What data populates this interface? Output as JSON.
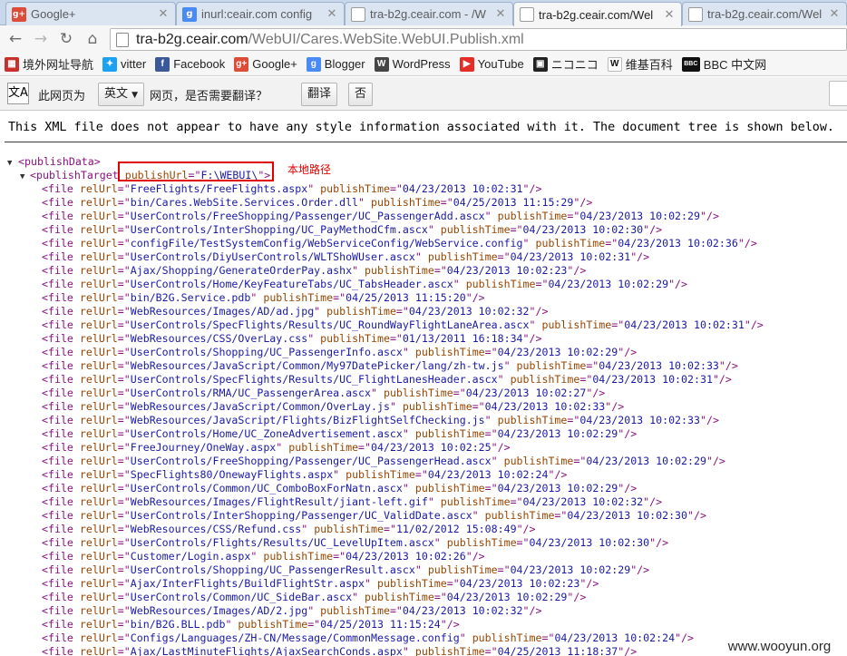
{
  "tabs": [
    {
      "title": "Google+",
      "icon": "google-plus-icon",
      "color": "#dd4b39"
    },
    {
      "title": "inurl:ceair.com config",
      "icon": "google-search-icon",
      "color": "#4a8af4"
    },
    {
      "title": "tra-b2g.ceair.com - /W",
      "icon": "page-icon",
      "color": "#ffffff"
    },
    {
      "title": "tra-b2g.ceair.com/Wel",
      "icon": "page-icon",
      "color": "#ffffff",
      "active": true
    },
    {
      "title": "tra-b2g.ceair.com/Wel",
      "icon": "page-icon",
      "color": "#ffffff"
    }
  ],
  "address": {
    "host": "tra-b2g.ceair.com",
    "path": "/WebUI/Cares.WebSite.WebUI.Publish.xml"
  },
  "bookmarks": [
    {
      "label": "境外网址导航",
      "icon": "flag-icon",
      "color": "#c9302c",
      "glyph": "▦"
    },
    {
      "label": "vitter",
      "icon": "twitter-bird-icon",
      "color": "#1da1f2",
      "glyph": "✦"
    },
    {
      "label": "Facebook",
      "icon": "facebook-icon",
      "color": "#3b5998",
      "glyph": "f"
    },
    {
      "label": "Google+",
      "icon": "google-plus-icon",
      "color": "#dd4b39",
      "glyph": "g+"
    },
    {
      "label": "Blogger",
      "icon": "blogger-icon",
      "color": "#4a8af4",
      "glyph": "g"
    },
    {
      "label": "WordPress",
      "icon": "wordpress-icon",
      "color": "#464646",
      "glyph": "W"
    },
    {
      "label": "YouTube",
      "icon": "youtube-icon",
      "color": "#e52d27",
      "glyph": "▶"
    },
    {
      "label": "ニコニコ",
      "icon": "niconico-icon",
      "color": "#222222",
      "glyph": "▣"
    },
    {
      "label": "维基百科",
      "icon": "wikipedia-icon",
      "color": "#ffffff",
      "glyph": "W"
    },
    {
      "label": "BBC 中文网",
      "icon": "bbc-icon",
      "color": "#111111",
      "glyph": "BBC"
    }
  ],
  "translate_bar": {
    "icon_glyph": "文A",
    "prefix": "此网页为",
    "language": "英文",
    "question": "网页，是否需要翻译？",
    "translate_button": "翻译",
    "no_button": "否"
  },
  "notice": "This XML file does not appear to have any style information associated with it. The document tree is shown below.",
  "xml": {
    "root_tag": "publishData",
    "target_tag": "publishTarget",
    "target_attr_name": "publishUrl",
    "target_attr_value": "F:\\WEBUI\\",
    "annotation": "本地路径",
    "file_tag": "file",
    "attr_rel": "relUrl",
    "attr_time": "publishTime",
    "files": [
      {
        "rel": "FreeFlights/FreeFlights.aspx",
        "time": "04/23/2013 10:02:31"
      },
      {
        "rel": "bin/Cares.WebSite.Services.Order.dll",
        "time": "04/25/2013 11:15:29"
      },
      {
        "rel": "UserControls/FreeShopping/Passenger/UC_PassengerAdd.ascx",
        "time": "04/23/2013 10:02:29"
      },
      {
        "rel": "UserControls/InterShopping/UC_PayMethodCfm.ascx",
        "time": "04/23/2013 10:02:30"
      },
      {
        "rel": "configFile/TestSystemConfig/WebServiceConfig/WebService.config",
        "time": "04/23/2013 10:02:36"
      },
      {
        "rel": "UserControls/DiyUserControls/WLTShoWUser.ascx",
        "time": "04/23/2013 10:02:31"
      },
      {
        "rel": "Ajax/Shopping/GenerateOrderPay.ashx",
        "time": "04/23/2013 10:02:23"
      },
      {
        "rel": "UserControls/Home/KeyFeatureTabs/UC_TabsHeader.ascx",
        "time": "04/23/2013 10:02:29"
      },
      {
        "rel": "bin/B2G.Service.pdb",
        "time": "04/25/2013 11:15:20"
      },
      {
        "rel": "WebResources/Images/AD/ad.jpg",
        "time": "04/23/2013 10:02:32"
      },
      {
        "rel": "UserControls/SpecFlights/Results/UC_RoundWayFlightLaneArea.ascx",
        "time": "04/23/2013 10:02:31"
      },
      {
        "rel": "WebResources/CSS/OverLay.css",
        "time": "01/13/2011 16:18:34"
      },
      {
        "rel": "UserControls/Shopping/UC_PassengerInfo.ascx",
        "time": "04/23/2013 10:02:29"
      },
      {
        "rel": "WebResources/JavaScript/Common/My97DatePicker/lang/zh-tw.js",
        "time": "04/23/2013 10:02:33"
      },
      {
        "rel": "UserControls/SpecFlights/Results/UC_FlightLanesHeader.ascx",
        "time": "04/23/2013 10:02:31"
      },
      {
        "rel": "UserControls/RMA/UC_PassengerArea.ascx",
        "time": "04/23/2013 10:02:27"
      },
      {
        "rel": "WebResources/JavaScript/Common/OverLay.js",
        "time": "04/23/2013 10:02:33"
      },
      {
        "rel": "WebResources/JavaScript/Flights/BizFlightSelfChecking.js",
        "time": "04/23/2013 10:02:33"
      },
      {
        "rel": "UserControls/Home/UC_ZoneAdvertisement.ascx",
        "time": "04/23/2013 10:02:29"
      },
      {
        "rel": "FreeJourney/OneWay.aspx",
        "time": "04/23/2013 10:02:25"
      },
      {
        "rel": "UserControls/FreeShopping/Passenger/UC_PassengerHead.ascx",
        "time": "04/23/2013 10:02:29"
      },
      {
        "rel": "SpecFlights80/OnewayFlights.aspx",
        "time": "04/23/2013 10:02:24"
      },
      {
        "rel": "UserControls/Common/UC_ComboBoxForNatn.ascx",
        "time": "04/23/2013 10:02:29"
      },
      {
        "rel": "WebResources/Images/FlightResult/jiant-left.gif",
        "time": "04/23/2013 10:02:32"
      },
      {
        "rel": "UserControls/InterShopping/Passenger/UC_ValidDate.ascx",
        "time": "04/23/2013 10:02:30"
      },
      {
        "rel": "WebResources/CSS/Refund.css",
        "time": "11/02/2012 15:08:49"
      },
      {
        "rel": "UserControls/Flights/Results/UC_LevelUpItem.ascx",
        "time": "04/23/2013 10:02:30"
      },
      {
        "rel": "Customer/Login.aspx",
        "time": "04/23/2013 10:02:26"
      },
      {
        "rel": "UserControls/Shopping/UC_PassengerResult.ascx",
        "time": "04/23/2013 10:02:29"
      },
      {
        "rel": "Ajax/InterFlights/BuildFlightStr.aspx",
        "time": "04/23/2013 10:02:23"
      },
      {
        "rel": "UserControls/Common/UC_SideBar.ascx",
        "time": "04/23/2013 10:02:29"
      },
      {
        "rel": "WebResources/Images/AD/2.jpg",
        "time": "04/23/2013 10:02:32"
      },
      {
        "rel": "bin/B2G.BLL.pdb",
        "time": "04/25/2013 11:15:24"
      },
      {
        "rel": "Configs/Languages/ZH-CN/Message/CommonMessage.config",
        "time": "04/23/2013 10:02:24"
      },
      {
        "rel": "Ajax/LastMinuteFlights/AjaxSearchConds.aspx",
        "time": "04/25/2013 11:18:37"
      }
    ]
  },
  "watermark": "www.wooyun.org",
  "colors": {
    "tag": "#881280",
    "attr_name": "#994500",
    "attr_value": "#1a1aa6",
    "annotation": "#e00000"
  }
}
